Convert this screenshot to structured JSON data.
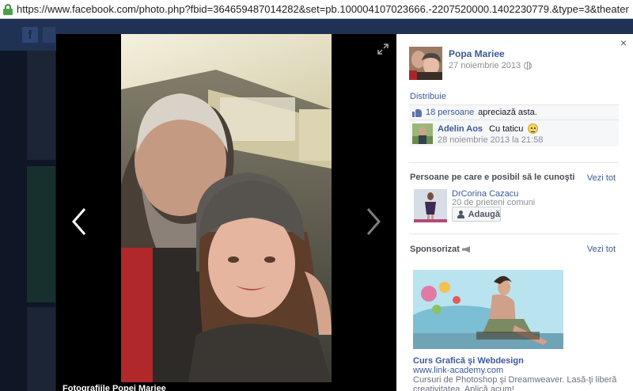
{
  "browser": {
    "url": "https://www.facebook.com/photo.php?fbid=364659487014282&set=pb.100004107023666.-2207520000.1402230779.&type=3&theater"
  },
  "background": {
    "logo_glyph": "f"
  },
  "viewer": {
    "album_caption": "Fotografiile Popei Mariee",
    "prev_glyph": "‹",
    "next_glyph": "›"
  },
  "panel": {
    "close_glyph": "×",
    "author": {
      "name": "Popa Mariee",
      "date": "27 noiembrie 2013"
    },
    "share_label": "Distribuie",
    "likes": {
      "count": "18 persoane",
      "text": "apreciază asta."
    },
    "comment": {
      "author": "Adelin Aos",
      "text": "Cu taticu",
      "timestamp": "28 noiembrie 2013 la 21:58"
    },
    "pymk": {
      "title": "Persoane pe care e posibil să le cunoşti",
      "see_all": "Vezi tot",
      "person": {
        "name": "DrCorina Cazacu",
        "mutual": "20 de prieteni comuni",
        "add_label": "Adaugă"
      }
    },
    "sponsored": {
      "title": "Sponsorizat",
      "see_all": "Vezi tot",
      "ad": {
        "title": "Curs Grafică şi Webdesign",
        "url": "www.link-academy.com",
        "description": "Cursuri de Photoshop şi Dreamweaver. Lasă-ţi liberă creativitatea. Aplică acum!"
      }
    }
  },
  "colors": {
    "link": "#3b5998",
    "stage": "#000000",
    "overlay": "#0f1626"
  }
}
